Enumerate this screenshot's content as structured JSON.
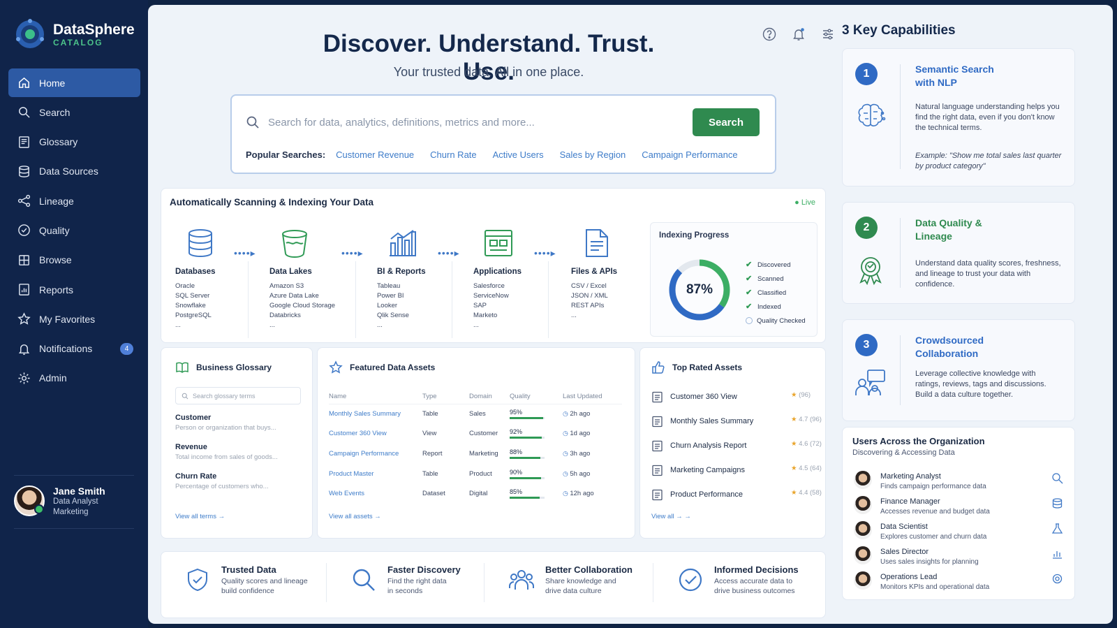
{
  "app": {
    "name": "DataSphere",
    "subtitle": "CATALOG"
  },
  "sidebar": {
    "items": [
      {
        "label": "Home",
        "icon": "home-icon",
        "active": true
      },
      {
        "label": "Search",
        "icon": "search-icon"
      },
      {
        "label": "Glossary",
        "icon": "book-icon"
      },
      {
        "label": "Data Sources",
        "icon": "database-icon"
      },
      {
        "label": "Lineage",
        "icon": "share-icon"
      },
      {
        "label": "Quality",
        "icon": "shield-check-icon"
      },
      {
        "label": "Browse",
        "icon": "grid-icon"
      },
      {
        "label": "Reports",
        "icon": "report-icon"
      },
      {
        "label": "My Favorites",
        "icon": "star-icon"
      },
      {
        "label": "Notifications",
        "icon": "bell-icon",
        "badge": "4"
      },
      {
        "label": "Admin",
        "icon": "gear-icon"
      }
    ]
  },
  "user": {
    "name": "Jane Smith",
    "role": "Data Analyst",
    "department": "Marketing"
  },
  "hero": {
    "title": "Discover. Understand. Trust. Use.",
    "subtitle": "Your trusted data.  All in one place."
  },
  "search": {
    "placeholder": "Search for data, analytics, definitions, metrics and more...",
    "button": "Search",
    "popular_label": "Popular Searches:",
    "popular": [
      "Customer Revenue",
      "Churn Rate",
      "Active Users",
      "Sales by Region",
      "Campaign Performance"
    ]
  },
  "scanning": {
    "title": "Automatically Scanning & Indexing Your Data",
    "live": "Live",
    "sources": [
      {
        "title": "Databases",
        "items": [
          "Oracle",
          "SQL Server",
          "Snowflake",
          "PostgreSQL",
          "..."
        ]
      },
      {
        "title": "Data Lakes",
        "items": [
          "Amazon S3",
          "Azure Data Lake",
          "Google Cloud Storage",
          "Databricks",
          "..."
        ]
      },
      {
        "title": "BI & Reports",
        "items": [
          "Tableau",
          "Power BI",
          "Looker",
          "Qlik Sense",
          "..."
        ]
      },
      {
        "title": "Applications",
        "items": [
          "Salesforce",
          "ServiceNow",
          "SAP",
          "Marketo",
          "..."
        ]
      },
      {
        "title": "Files & APIs",
        "items": [
          "CSV / Excel",
          "JSON / XML",
          "REST APIs",
          "..."
        ]
      }
    ],
    "progress": {
      "title": "Indexing Progress",
      "percent": 87,
      "percent_label": "87%",
      "steps": [
        {
          "label": "Discovered",
          "done": true
        },
        {
          "label": "Scanned",
          "done": true
        },
        {
          "label": "Classified",
          "done": true
        },
        {
          "label": "Indexed",
          "done": true
        },
        {
          "label": "Quality Checked",
          "done": false
        }
      ]
    }
  },
  "glossary": {
    "title": "Business Glossary",
    "search_placeholder": "Search glossary terms",
    "terms": [
      {
        "name": "Customer",
        "desc": "Person or organization that buys..."
      },
      {
        "name": "Revenue",
        "desc": "Total income from sales of goods..."
      },
      {
        "name": "Churn Rate",
        "desc": "Percentage of customers who..."
      }
    ],
    "view_all": "View all terms →"
  },
  "featured": {
    "title": "Featured Data Assets",
    "columns": [
      "Name",
      "Type",
      "Domain",
      "Quality",
      "Last Updated"
    ],
    "rows": [
      {
        "name": "Monthly Sales Summary",
        "type": "Table",
        "domain": "Sales",
        "quality": "95%",
        "q": 95,
        "updated": "2h ago"
      },
      {
        "name": "Customer 360 View",
        "type": "View",
        "domain": "Customer",
        "quality": "92%",
        "q": 92,
        "updated": "1d ago"
      },
      {
        "name": "Campaign Performance",
        "type": "Report",
        "domain": "Marketing",
        "quality": "88%",
        "q": 88,
        "updated": "3h ago"
      },
      {
        "name": "Product Master",
        "type": "Table",
        "domain": "Product",
        "quality": "90%",
        "q": 90,
        "updated": "5h ago"
      },
      {
        "name": "Web Events",
        "type": "Dataset",
        "domain": "Digital",
        "quality": "85%",
        "q": 85,
        "updated": "12h ago"
      }
    ],
    "view_all": "View all assets →"
  },
  "top_rated": {
    "title": "Top Rated Assets",
    "items": [
      {
        "name": "Customer 360 View",
        "rating": "(96)"
      },
      {
        "name": "Monthly Sales Summary",
        "rating": "4.7 (96)"
      },
      {
        "name": "Churn Analysis Report",
        "rating": "4.6 (72)"
      },
      {
        "name": "Marketing Campaigns",
        "rating": "4.5 (64)"
      },
      {
        "name": "Product Performance",
        "rating": "4.4 (58)"
      }
    ],
    "view_all": "View all → →"
  },
  "benefits": [
    {
      "title": "Trusted Data",
      "desc1": "Quality scores and lineage",
      "desc2": "build confidence",
      "icon": "shield-check-icon"
    },
    {
      "title": "Faster Discovery",
      "desc1": "Find the right data",
      "desc2": "in seconds",
      "icon": "search-icon"
    },
    {
      "title": "Better Collaboration",
      "desc1": "Share knowledge and",
      "desc2": "drive data culture",
      "icon": "people-icon"
    },
    {
      "title": "Informed Decisions",
      "desc1": "Access accurate data to",
      "desc2": "drive business outcomes",
      "icon": "check-circle-icon"
    }
  ],
  "capabilities": {
    "title": "3 Key Capabilities",
    "items": [
      {
        "num": "1",
        "title1": "Semantic Search",
        "title2": "with NLP",
        "desc": "Natural language understanding helps you find the right data, even if you don't know the technical terms.",
        "example": "Example: \"Show me total sales last quarter by product category\"",
        "color": "#2f6ac4",
        "icon": "brain-icon"
      },
      {
        "num": "2",
        "title1": "Data Quality &",
        "title2": "Lineage",
        "desc": "Understand data quality scores, freshness, and lineage to trust your data with confidence.",
        "color": "#2f8a4f",
        "icon": "award-icon"
      },
      {
        "num": "3",
        "title1": "Crowdsourced",
        "title2": "Collaboration",
        "desc": "Leverage collective knowledge with ratings, reviews, tags and discussions.",
        "desc2": "Build a data culture together.",
        "color": "#2f6ac4",
        "icon": "collaboration-icon"
      }
    ]
  },
  "users": {
    "title": "Users Across the Organization",
    "subtitle": "Discovering & Accessing Data",
    "rows": [
      {
        "role": "Marketing Analyst",
        "desc": "Finds campaign performance data",
        "icon": "search-icon"
      },
      {
        "role": "Finance Manager",
        "desc": "Accesses revenue and budget data",
        "icon": "database-icon"
      },
      {
        "role": "Data Scientist",
        "desc": "Explores customer and churn data",
        "icon": "flask-icon"
      },
      {
        "role": "Sales Director",
        "desc": "Uses sales insights for planning",
        "icon": "chart-icon"
      },
      {
        "role": "Operations Lead",
        "desc": "Monitors KPIs and operational data",
        "icon": "gear-icon"
      }
    ]
  },
  "colors": {
    "accent": "#2d5aa4",
    "green": "#2f8a4f",
    "link": "#3e7cc9",
    "sidebar": "#10244a"
  }
}
